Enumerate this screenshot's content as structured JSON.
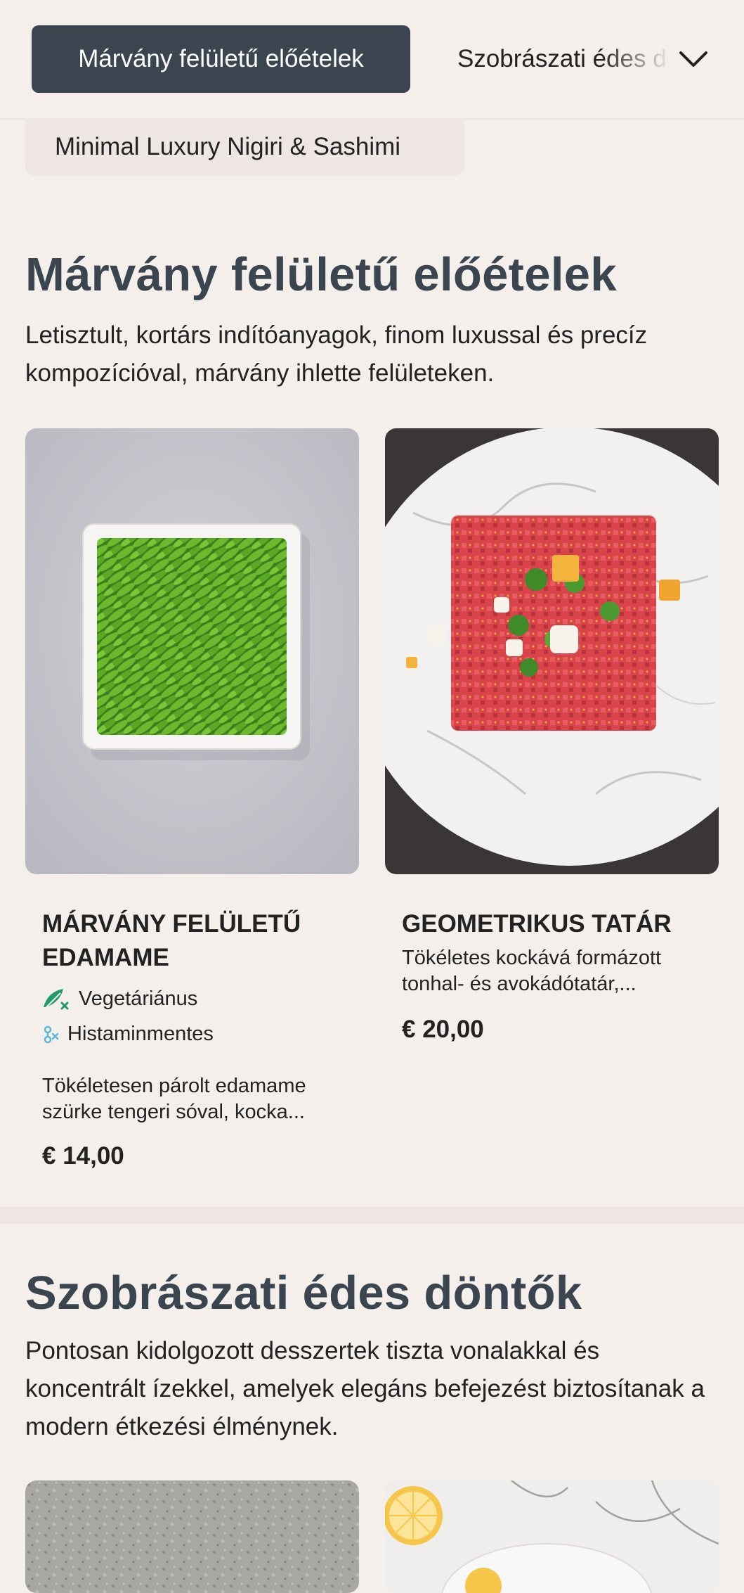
{
  "nav": {
    "active_tab": "Márvány felületű előételek",
    "next_tab": "Szobrászati édes döntők",
    "prev_category": "Minimal Luxury Nigiri & Sashimi"
  },
  "sections": [
    {
      "title": "Márvány felületű előételek",
      "description": "Letisztult, kortárs indítóanyagok, finom luxussal és precíz kompozícióval, márvány ihlette felületeken.",
      "dishes": [
        {
          "name": "Márvány felületű Edamame",
          "tags": [
            {
              "icon": "vegetarian-icon",
              "label": "Vegetáriánus"
            },
            {
              "icon": "histamine-free-icon",
              "label": "Histaminmentes"
            }
          ],
          "description": "Tökéletesen párolt edamame szürke tengeri sóval, kocka...",
          "price": "€ 14,00"
        },
        {
          "name": "Geometrikus Tatár",
          "tags": [],
          "description": "Tökéletes kockává formázott tonhal- és avokádótatár,...",
          "price": "€ 20,00"
        }
      ]
    },
    {
      "title": "Szobrászati édes döntők",
      "description": "Pontosan kidolgozott desszertek tiszta vonalakkal és koncentrált ízekkel, amelyek elegáns befejezést biztosítanak a modern étkezési élménynek."
    }
  ],
  "colors": {
    "background": "#f5efeb",
    "active_tab": "#3b4550",
    "heading": "#3b4550",
    "vegetarian_icon": "#1f9a6a",
    "histamine_icon": "#5bb7d5"
  }
}
